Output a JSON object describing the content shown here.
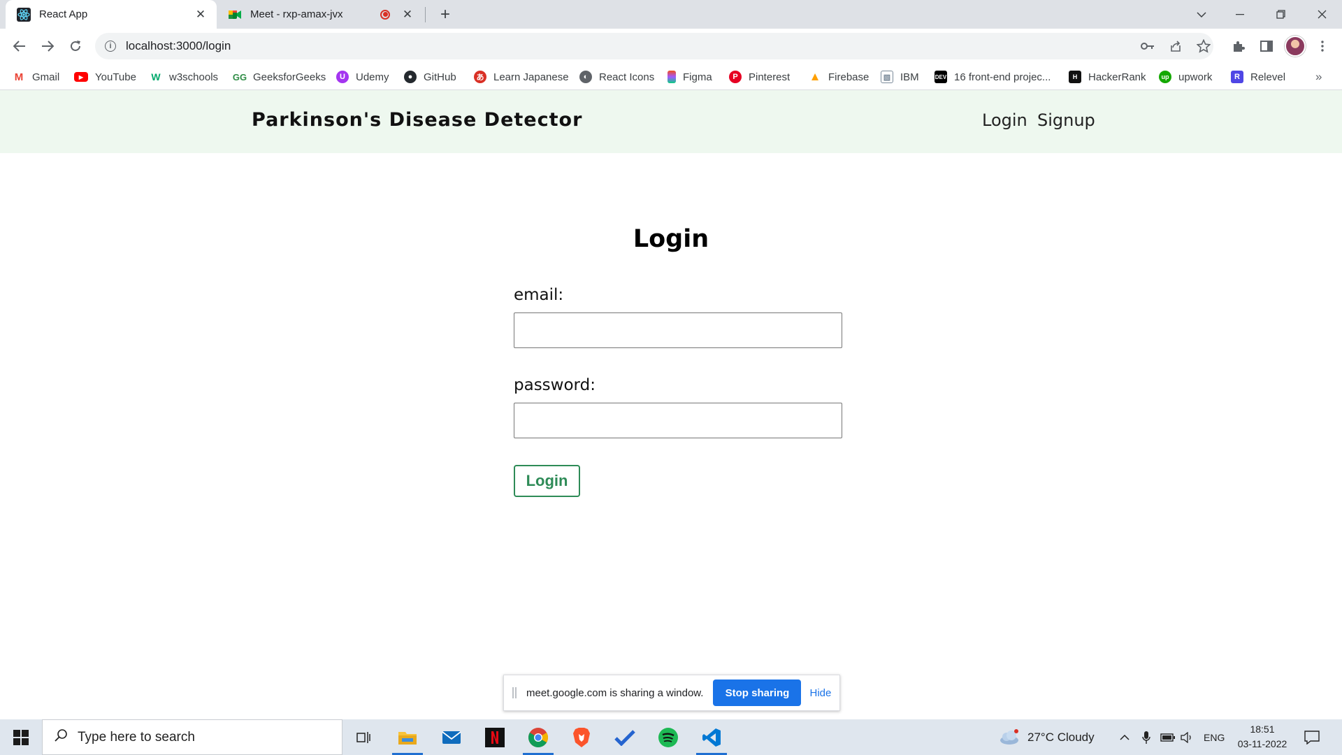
{
  "browser": {
    "tabs": [
      {
        "title": "React App"
      },
      {
        "title": "Meet - rxp-amax-jvx"
      }
    ],
    "url": "localhost:3000/login",
    "bookmarks": [
      {
        "label": "Gmail",
        "icon": "gmail-icon",
        "color": "#ea4335"
      },
      {
        "label": "YouTube",
        "icon": "youtube-icon",
        "color": "#ff0000"
      },
      {
        "label": "w3schools",
        "icon": "w3schools-icon",
        "color": "#04aa6d"
      },
      {
        "label": "GeeksforGeeks",
        "icon": "geeksforgeeks-icon",
        "color": "#2f8d46"
      },
      {
        "label": "Udemy",
        "icon": "udemy-icon",
        "color": "#a435f0"
      },
      {
        "label": "GitHub",
        "icon": "github-icon",
        "color": "#24292e"
      },
      {
        "label": "Learn Japanese",
        "icon": "learn-japanese-icon",
        "color": "#d93025"
      },
      {
        "label": "React Icons",
        "icon": "react-icons-icon",
        "color": "#5f6368"
      },
      {
        "label": "Figma",
        "icon": "figma-icon",
        "color": "#f24e1e"
      },
      {
        "label": "Pinterest",
        "icon": "pinterest-icon",
        "color": "#e60023"
      },
      {
        "label": "Firebase",
        "icon": "firebase-icon",
        "color": "#ffa000"
      },
      {
        "label": "IBM",
        "icon": "ibm-icon",
        "color": "#7a8a99"
      },
      {
        "label": "16 front-end projec...",
        "icon": "dev-icon",
        "color": "#000000"
      },
      {
        "label": "HackerRank",
        "icon": "hackerrank-icon",
        "color": "#111111"
      },
      {
        "label": "upwork",
        "icon": "upwork-icon",
        "color": "#14a800"
      },
      {
        "label": "Relevel",
        "icon": "relevel-icon",
        "color": "#4f46e5"
      }
    ]
  },
  "app": {
    "brand": "Parkinson's Disease Detector",
    "nav": {
      "login": "Login",
      "signup": "Signup"
    },
    "form": {
      "title": "Login",
      "email_label": "email:",
      "email_value": "",
      "password_label": "password:",
      "password_value": "",
      "submit_label": "Login"
    },
    "colors": {
      "navbar_bg": "#eef8ef",
      "button_accent": "#2e8b57"
    }
  },
  "share_bar": {
    "message": "meet.google.com is sharing a window.",
    "stop_label": "Stop sharing",
    "hide_label": "Hide"
  },
  "taskbar": {
    "search_placeholder": "Type here to search",
    "weather": "27°C  Cloudy",
    "language": "ENG",
    "time": "18:51",
    "date": "03-11-2022"
  }
}
